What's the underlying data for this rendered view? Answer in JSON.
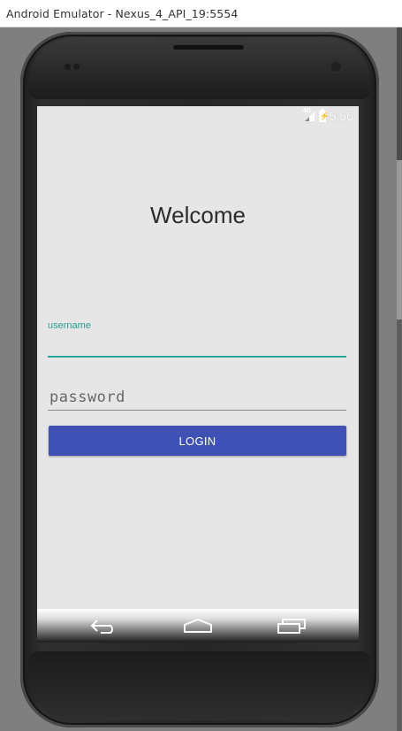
{
  "window": {
    "title": "Android Emulator - Nexus_4_API_19:5554"
  },
  "status_bar": {
    "network": "4G",
    "time": "5:56"
  },
  "app": {
    "heading": "Welcome",
    "username_label": "username",
    "username_value": "",
    "password_placeholder": "password",
    "password_value": "",
    "login_label": "LOGIN"
  },
  "nav_bar": {
    "icons": [
      "back-icon",
      "home-icon",
      "recent-apps-icon"
    ]
  },
  "colors": {
    "accent": "#26a69a",
    "button": "#3f51b5",
    "screen_bg": "#e6e6e6",
    "emulator_bg": "#7f7f7f"
  }
}
